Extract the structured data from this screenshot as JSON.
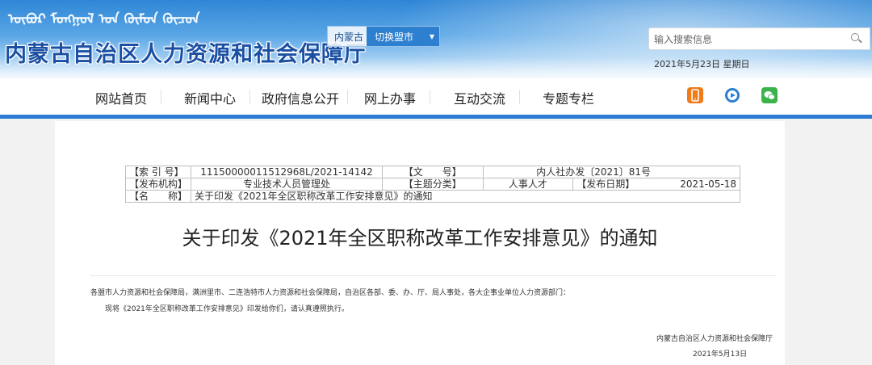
{
  "header": {
    "mongolian_script": "ᠥᠪᠥᠷ ᠮᠣᠩᠭᠣᠯ ᠤᠨ ᠬᠦᠮᠦᠨ ᠬᠦᠴᠦᠨ",
    "site_title": "内蒙古自治区人力资源和社会保障厅",
    "region_label": "内蒙古",
    "region_select": "切换盟市",
    "search_placeholder": "输入搜索信息",
    "date": "2021年5月23日 星期日"
  },
  "nav": {
    "items": [
      "网站首页",
      "新闻中心",
      "政府信息公开",
      "网上办事",
      "互动交流",
      "专题专栏"
    ],
    "icons": [
      "mobile-app-icon",
      "video-icon",
      "wechat-icon"
    ]
  },
  "meta": {
    "index_label": "【索 引 号】",
    "index_value": "11150000011512968L/2021-14142",
    "docno_label": "【文　　号】",
    "docno_value": "内人社办发〔2021〕81号",
    "org_label": "【发布机构】",
    "org_value": "专业技术人员管理处",
    "topic_label": "【主题分类】",
    "topic_value": "人事人才",
    "pubdate_label": "【发布日期】",
    "pubdate_value": "2021-05-18",
    "name_label": "【名　　称】",
    "name_value": "关于印发《2021年全区职称改革工作安排意见》的通知"
  },
  "document": {
    "title": "关于印发《2021年全区职称改革工作安排意见》的通知",
    "salutation": "各盟市人力资源和社会保障局，满洲里市、二连浩特市人力资源和社会保障局，自治区各部、委、办、厅、局人事处，各大企事业单位人力资源部门：",
    "body": "现将《2021年全区职称改革工作安排意见》印发给你们，请认真遵照执行。",
    "signature": "内蒙古自治区人力资源和社会保障厅",
    "sign_date": "2021年5月13日"
  }
}
